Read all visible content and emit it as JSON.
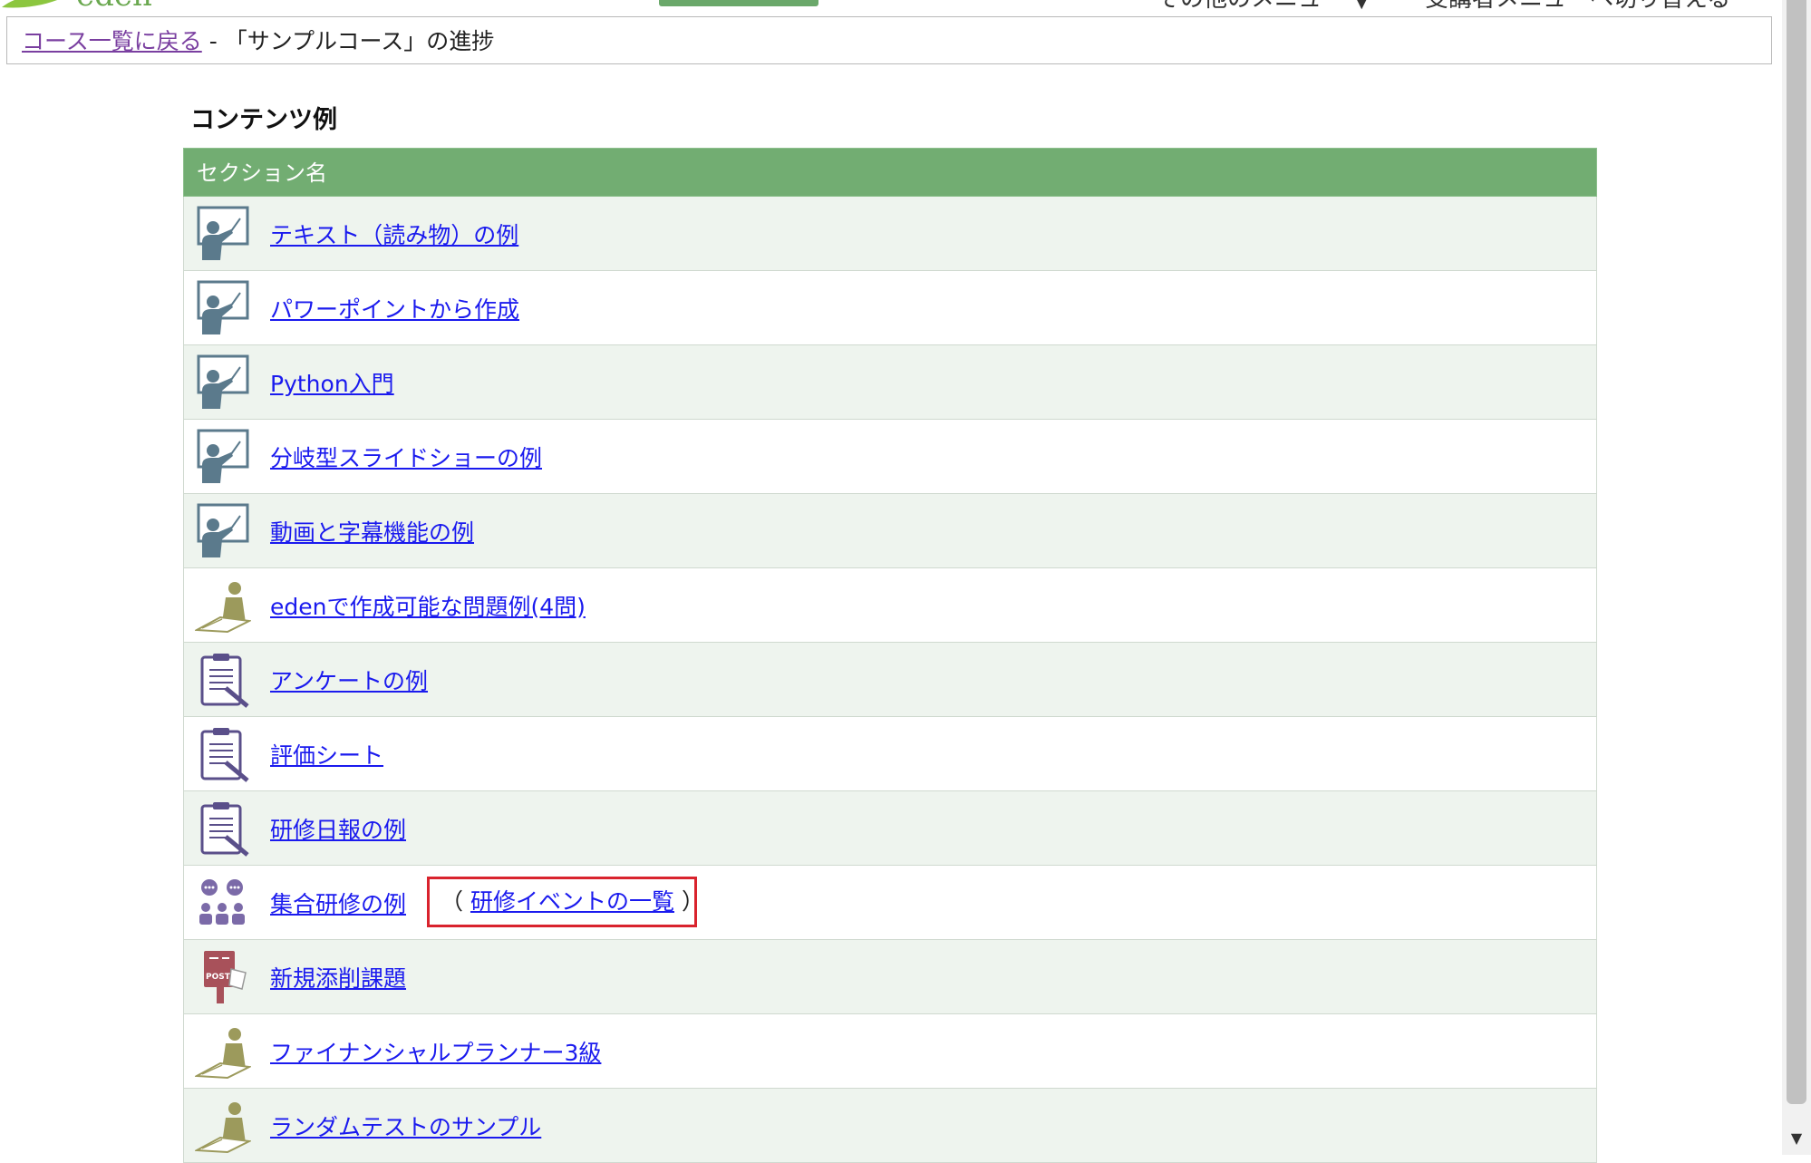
{
  "header": {
    "logo_text": "eden",
    "other_menu": "その他のメニュー",
    "switch_menu": "受講者メニューへ切り替える"
  },
  "breadcrumb": {
    "back_link": "コース一覧に戻る",
    "separator": " - ",
    "current": "「サンプルコース」の進捗"
  },
  "section": {
    "title": "コンテンツ例",
    "header_label": "セクション名"
  },
  "items": [
    {
      "label": "テキスト（読み物）の例",
      "icon": "lecture-icon"
    },
    {
      "label": "パワーポイントから作成",
      "icon": "lecture-icon"
    },
    {
      "label": "Python入門",
      "icon": "lecture-icon"
    },
    {
      "label": "分岐型スライドショーの例",
      "icon": "lecture-icon"
    },
    {
      "label": "動画と字幕機能の例",
      "icon": "lecture-icon"
    },
    {
      "label": "edenで作成可能な問題例(4問)",
      "icon": "test-icon"
    },
    {
      "label": "アンケートの例",
      "icon": "survey-icon"
    },
    {
      "label": "評価シート",
      "icon": "survey-icon"
    },
    {
      "label": "研修日報の例",
      "icon": "survey-icon"
    },
    {
      "label": "集合研修の例",
      "icon": "group-training-icon",
      "event_link": "研修イベントの一覧",
      "event_open": "（",
      "event_close": "）"
    },
    {
      "label": "新規添削課題",
      "icon": "post-icon"
    },
    {
      "label": "ファイナンシャルプランナー3級",
      "icon": "test-icon"
    },
    {
      "label": "ランダムテストのサンプル",
      "icon": "test-icon"
    }
  ],
  "colors": {
    "header_green": "#72ad72",
    "row_alt": "#eef4ee",
    "link": "#1a1aee",
    "highlight": "#d9232d"
  }
}
